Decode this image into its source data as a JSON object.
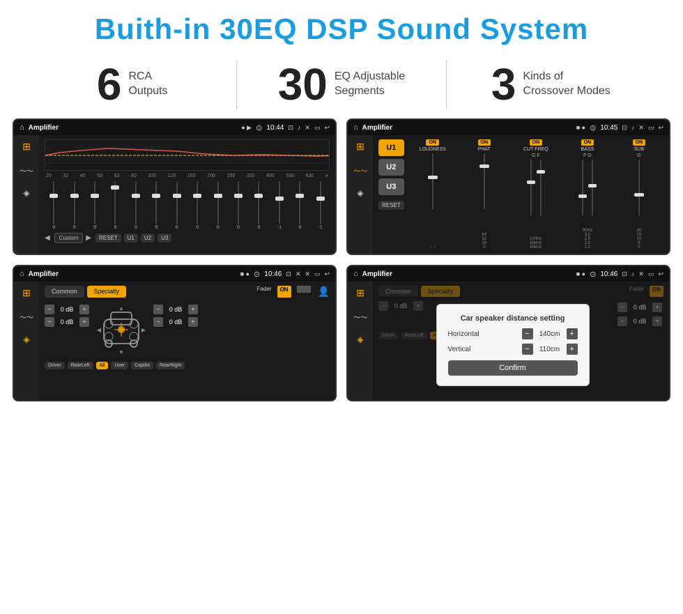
{
  "header": {
    "title": "Buith-in 30EQ DSP Sound System"
  },
  "stats": [
    {
      "number": "6",
      "line1": "RCA",
      "line2": "Outputs"
    },
    {
      "number": "30",
      "line1": "EQ Adjustable",
      "line2": "Segments"
    },
    {
      "number": "3",
      "line1": "Kinds of",
      "line2": "Crossover Modes"
    }
  ],
  "screens": [
    {
      "id": "eq-screen",
      "statusTitle": "Amplifier",
      "statusTime": "10:44",
      "type": "eq",
      "eqLabels": [
        "25",
        "32",
        "40",
        "50",
        "63",
        "80",
        "100",
        "125",
        "160",
        "200",
        "250",
        "320",
        "400",
        "500",
        "630"
      ],
      "eqValues": [
        "0",
        "0",
        "0",
        "5",
        "0",
        "0",
        "0",
        "0",
        "0",
        "0",
        "0",
        "-1",
        "0",
        "-1"
      ],
      "navLabels": [
        "Custom",
        "RESET",
        "U1",
        "U2",
        "U3"
      ]
    },
    {
      "id": "crossover-screen",
      "statusTitle": "Amplifier",
      "statusTime": "10:45",
      "type": "crossover",
      "uButtons": [
        "U1",
        "U2",
        "U3"
      ],
      "controls": [
        {
          "toggle": "ON",
          "label": "LOUDNESS"
        },
        {
          "toggle": "ON",
          "label": "PHAT"
        },
        {
          "toggle": "ON",
          "label": "CUT FREQ"
        },
        {
          "toggle": "ON",
          "label": "BASS"
        },
        {
          "toggle": "ON",
          "label": "SUB"
        }
      ],
      "resetLabel": "RESET"
    },
    {
      "id": "fader-screen",
      "statusTitle": "Amplifier",
      "statusTime": "10:46",
      "type": "fader",
      "tabs": [
        "Common",
        "Specialty"
      ],
      "activeTab": "Specialty",
      "faderLabel": "Fader",
      "faderToggle": "ON",
      "volRows": [
        {
          "label": "0 dB"
        },
        {
          "label": "0 dB"
        },
        {
          "label": "0 dB"
        },
        {
          "label": "0 dB"
        }
      ],
      "navBtns": [
        "Driver",
        "RearLeft",
        "All",
        "User",
        "Copilot",
        "RearRight"
      ]
    },
    {
      "id": "confirm-screen",
      "statusTitle": "Amplifier",
      "statusTime": "10:46",
      "type": "confirm",
      "tabs": [
        "Common",
        "Specialty"
      ],
      "activeTab": "Specialty",
      "faderLabel": "Fader",
      "faderToggle": "ON",
      "dialog": {
        "title": "Car speaker distance setting",
        "fields": [
          {
            "label": "Horizontal",
            "value": "140cm"
          },
          {
            "label": "Vertical",
            "value": "110cm"
          }
        ],
        "confirmLabel": "Confirm",
        "volRows": [
          {
            "label": "0 dB"
          },
          {
            "label": "0 dB"
          }
        ]
      }
    }
  ],
  "icons": {
    "home": "⌂",
    "eq": "≡",
    "wave": "〜",
    "speaker": "◈",
    "back": "↩",
    "location": "⊙",
    "camera": "⊡",
    "volume": "♪",
    "close": "✕",
    "window": "▭",
    "chevronRight": "»",
    "chevronLeft": "◀",
    "chevronDown": "▼",
    "chevronUp": "▲",
    "plus": "+",
    "minus": "−",
    "tuner": "⊞",
    "person": "👤"
  }
}
